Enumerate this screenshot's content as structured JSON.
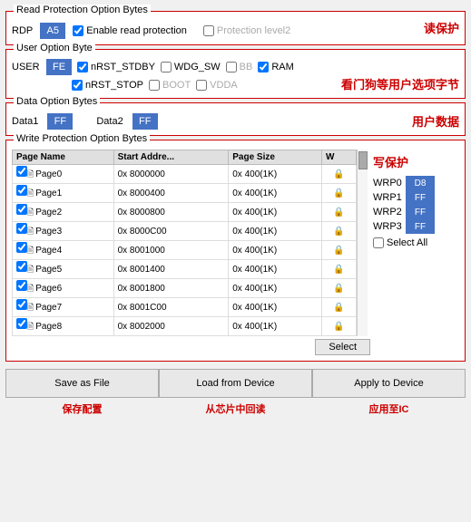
{
  "sections": {
    "read_protection": {
      "label": "Read Protection Option Bytes",
      "cn_note": "读保护",
      "rdp_label": "RDP",
      "rdp_value": "A5",
      "enable_read_protection": "Enable read protection",
      "enable_checked": true,
      "protection_level2": "Protection level2",
      "protection_checked": false
    },
    "user_option": {
      "label": "User Option Byte",
      "cn_note": "看门狗等用户选项字节",
      "user_label": "USER",
      "user_value": "FE",
      "nrst_stdby": "nRST_STDBY",
      "nrst_stdby_checked": true,
      "wdg_sw": "WDG_SW",
      "wdg_checked": false,
      "bb": "BB",
      "bb_checked": false,
      "ram": "RAM",
      "ram_checked": true,
      "nrst_stop": "nRST_STOP",
      "nrst_stop_checked": true,
      "boot": "BOOT",
      "boot_checked": false,
      "vdda": "VDDA",
      "vdda_checked": false
    },
    "data_option": {
      "label": "Data Option Bytes",
      "cn_note": "用户数据",
      "data1_label": "Data1",
      "data1_value": "FF",
      "data2_label": "Data2",
      "data2_value": "FF"
    },
    "write_protection": {
      "label": "Write Protection Option Bytes",
      "cn_note": "写保护",
      "columns": [
        "Page Name",
        "Start Addre...",
        "Page Size",
        "W"
      ],
      "rows": [
        {
          "checked": true,
          "page": "Page0",
          "addr": "0x 8000000",
          "size": "0x 400(1K)",
          "locked": true
        },
        {
          "checked": true,
          "page": "Page1",
          "addr": "0x 8000400",
          "size": "0x 400(1K)",
          "locked": true
        },
        {
          "checked": true,
          "page": "Page2",
          "addr": "0x 8000800",
          "size": "0x 400(1K)",
          "locked": true
        },
        {
          "checked": true,
          "page": "Page3",
          "addr": "0x 8000C00",
          "size": "0x 400(1K)",
          "locked": true
        },
        {
          "checked": true,
          "page": "Page4",
          "addr": "0x 8001000",
          "size": "0x 400(1K)",
          "locked": true
        },
        {
          "checked": true,
          "page": "Page5",
          "addr": "0x 8001400",
          "size": "0x 400(1K)",
          "locked": true
        },
        {
          "checked": true,
          "page": "Page6",
          "addr": "0x 8001800",
          "size": "0x 400(1K)",
          "locked": true
        },
        {
          "checked": true,
          "page": "Page7",
          "addr": "0x 8001C00",
          "size": "0x 400(1K)",
          "locked": true
        },
        {
          "checked": true,
          "page": "Page8",
          "addr": "0x 8002000",
          "size": "0x 400(1K)",
          "locked": true
        }
      ],
      "wrp_fields": [
        {
          "label": "WRP0",
          "value": "D8"
        },
        {
          "label": "WRP1",
          "value": "FF"
        },
        {
          "label": "WRP2",
          "value": "FF"
        },
        {
          "label": "WRP3",
          "value": "FF"
        }
      ],
      "select_label": "Select",
      "select_all_label": "Select All"
    }
  },
  "buttons": {
    "save_file": "Save as File",
    "load_device": "Load from Device",
    "apply_device": "Apply to Device"
  },
  "notes": {
    "save": "保存配置",
    "load": "从芯片中回读",
    "apply": "应用至IC"
  }
}
